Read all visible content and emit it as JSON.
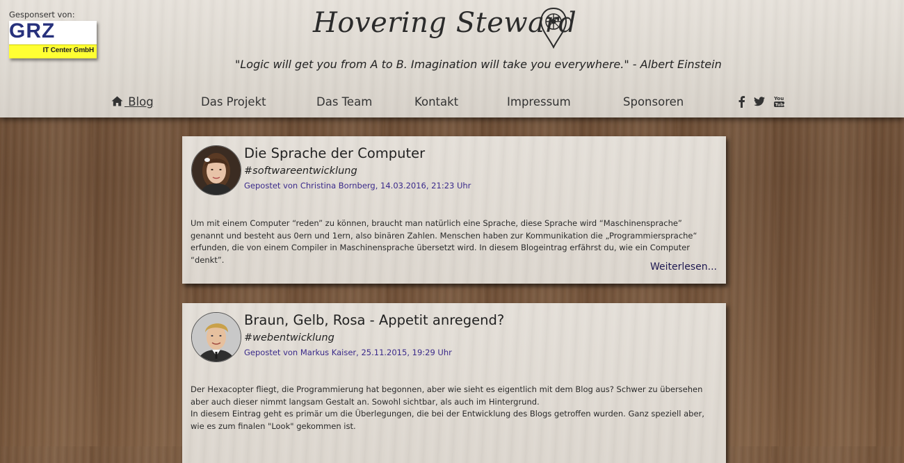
{
  "sponsor": {
    "label": "Gesponsert von:",
    "logo_text": "GRZ",
    "logo_subtitle": "IT Center GmbH"
  },
  "site": {
    "title": "Hovering Steward",
    "quote": "\"Logic will get you from A to B. Imagination will take you everywhere.\" - Albert Einstein"
  },
  "nav": {
    "items": [
      {
        "label": " Blog"
      },
      {
        "label": "Das Projekt"
      },
      {
        "label": "Das Team"
      },
      {
        "label": "Kontakt"
      },
      {
        "label": "Impressum"
      },
      {
        "label": "Sponsoren"
      }
    ],
    "social": [
      "facebook-icon",
      "twitter-icon",
      "youtube-icon"
    ]
  },
  "posts": [
    {
      "title": "Die Sprache der Computer",
      "tag": "#softwareentwicklung",
      "meta": "Gepostet von Christina Bornberg, 14.03.2016, 21:23 Uhr",
      "body": "Um mit einem Computer “reden” zu können, braucht man natürlich eine Sprache, diese Sprache wird “Maschinensprache” genannt und besteht aus 0ern und 1ern, also binären Zahlen. Menschen haben zur Kommunikation die „Programmiersprache“ erfunden, die von einem Compiler in Maschinensprache übersetzt wird. In diesem Blogeintrag erfährst du, wie ein Computer “denkt”.",
      "read_more": "Weiterlesen..."
    },
    {
      "title": "Braun, Gelb, Rosa - Appetit anregend?",
      "tag": "#webentwicklung",
      "meta": "Gepostet von Markus Kaiser, 25.11.2015, 19:29 Uhr",
      "body_line1": "Der Hexacopter fliegt, die Programmierung hat begonnen, aber wie sieht es eigentlich mit dem Blog aus? Schwer zu übersehen aber auch dieser nimmt langsam Gestalt an. Sowohl sichtbar, als auch im Hintergrund.",
      "body_line2": "In diesem Eintrag geht es primär um die Überlegungen, die bei der Entwicklung des Blogs getroffen wurden. Ganz speziell aber, wie es zum finalen \"Look\" gekommen ist."
    }
  ],
  "colors": {
    "accent_meta": "#3a2a8a",
    "logo_yellow": "#ffff33",
    "logo_blue": "#27317c"
  }
}
